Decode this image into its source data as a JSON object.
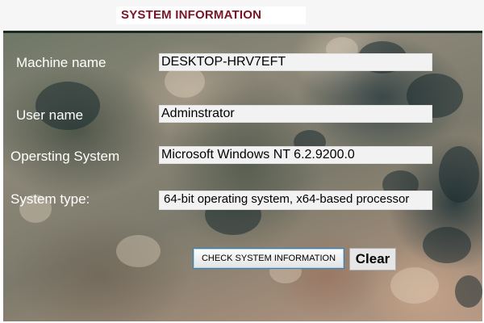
{
  "window": {
    "title": "SYSTEM INFORMATION"
  },
  "fields": {
    "machine_name": {
      "label": "Machine name",
      "value": "DESKTOP-HRV7EFT"
    },
    "user_name": {
      "label": "User name",
      "value": "Adminstrator"
    },
    "operating_system": {
      "label": "Opersting System",
      "value": "Microsoft Windows NT 6.2.9200.0"
    },
    "system_type": {
      "label": "System type:",
      "value": "64-bit operating system, x64-based processor"
    }
  },
  "buttons": {
    "check_label": "CHECK SYSTEM INFORMATION",
    "clear_label": "Clear"
  },
  "colors": {
    "title": "#7a1426",
    "label_text": "#ffffff",
    "field_background": "#f2f2f2",
    "check_button_border": "#3c7fb1"
  }
}
